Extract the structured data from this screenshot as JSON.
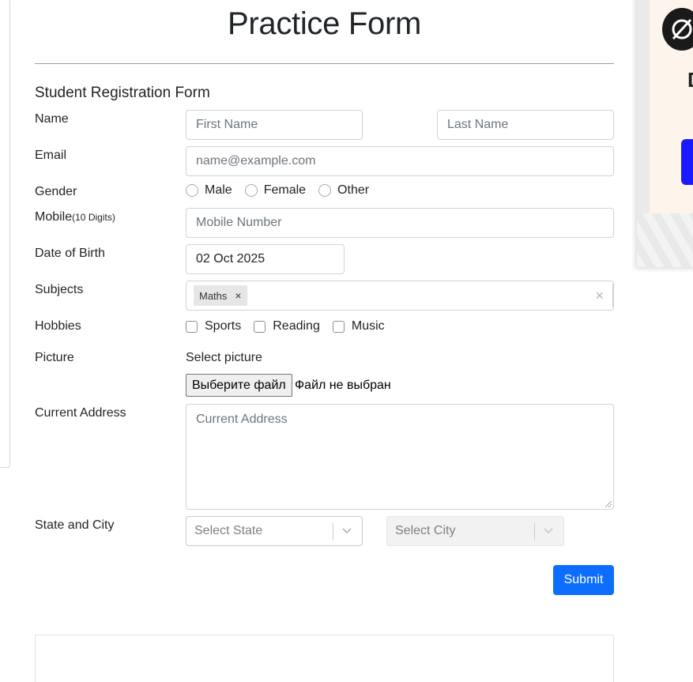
{
  "page": {
    "title": "Practice Form",
    "form_heading": "Student Registration Form"
  },
  "labels": {
    "name": "Name",
    "email": "Email",
    "gender": "Gender",
    "mobile": "Mobile",
    "mobile_hint": "(10 Digits)",
    "dob": "Date of Birth",
    "subjects": "Subjects",
    "hobbies": "Hobbies",
    "picture": "Picture",
    "address": "Current Address",
    "state_city": "State and City"
  },
  "fields": {
    "first_name_placeholder": "First Name",
    "last_name_placeholder": "Last Name",
    "email_placeholder": "name@example.com",
    "mobile_placeholder": "Mobile Number",
    "dob_value": "02 Oct 2025",
    "address_placeholder": "Current Address"
  },
  "gender_options": [
    "Male",
    "Female",
    "Other"
  ],
  "subjects": {
    "chips": [
      "Maths"
    ],
    "chip_remove": "×",
    "clear": "×"
  },
  "hobbies": [
    "Sports",
    "Reading",
    "Music"
  ],
  "picture": {
    "caption": "Select picture",
    "button": "Выберите файл",
    "status": "Файл не выбран"
  },
  "state_select": {
    "placeholder": "Select State"
  },
  "city_select": {
    "placeholder": "Select City",
    "disabled": true
  },
  "submit_label": "Submit",
  "colors": {
    "primary": "#0d6efd",
    "border": "#ced4da",
    "text": "#212529",
    "placeholder": "#6c757d"
  },
  "icons": {
    "select_chevron": "chevron-down-icon",
    "ad_logo": "brand-logo-icon"
  }
}
